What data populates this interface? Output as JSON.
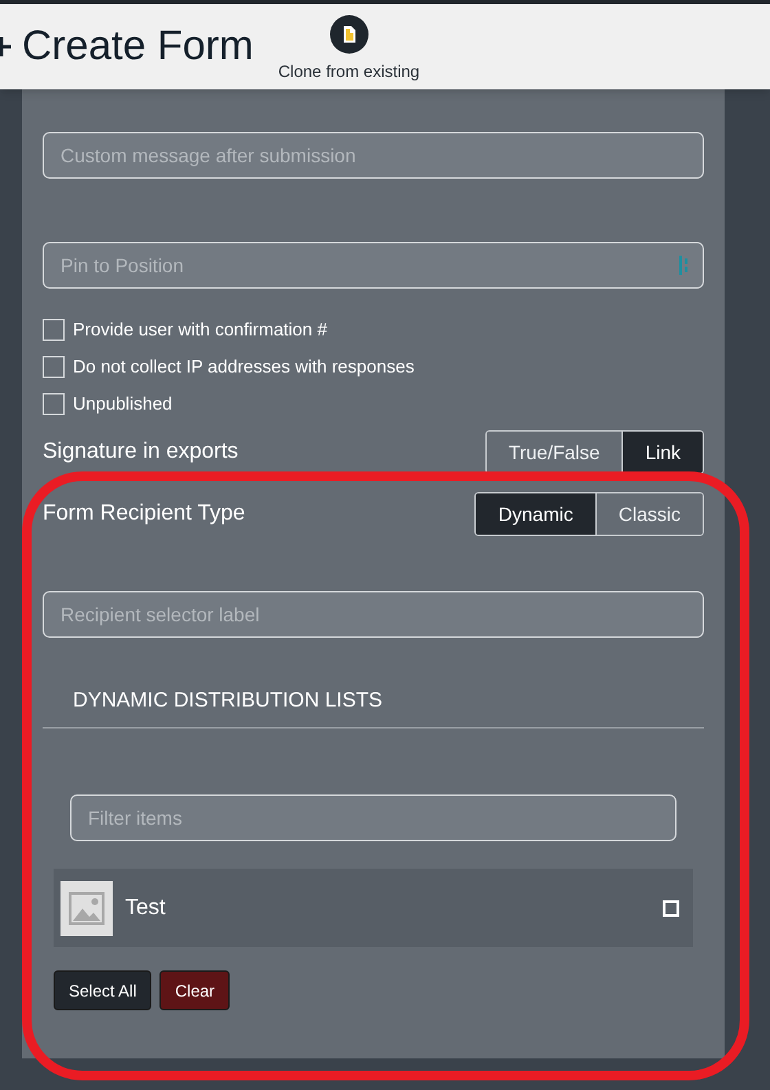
{
  "header": {
    "title": "Create Form",
    "clone_label": "Clone from existing"
  },
  "fields": {
    "custom_message": {
      "placeholder": "Custom message after submission"
    },
    "pin": {
      "placeholder": "Pin to Position"
    }
  },
  "checkboxes": [
    {
      "label": "Provide user with confirmation #",
      "checked": false
    },
    {
      "label": "Do not collect IP addresses with responses",
      "checked": false
    },
    {
      "label": "Unpublished",
      "checked": false
    }
  ],
  "signature": {
    "label": "Signature in exports",
    "options": [
      {
        "label": "True/False",
        "selected": false
      },
      {
        "label": "Link",
        "selected": true
      }
    ]
  },
  "recipient": {
    "label": "Form Recipient Type",
    "options": [
      {
        "label": "Dynamic",
        "selected": true
      },
      {
        "label": "Classic",
        "selected": false
      }
    ]
  },
  "selector_label": {
    "placeholder": "Recipient selector label"
  },
  "distribution": {
    "heading": "DYNAMIC DISTRIBUTION LISTS",
    "filter": {
      "placeholder": "Filter items"
    },
    "items": [
      {
        "name": "Test",
        "checked": false
      }
    ],
    "buttons": [
      {
        "label": "Select All",
        "kind": "neutral"
      },
      {
        "label": "Clear",
        "kind": "danger"
      }
    ]
  }
}
